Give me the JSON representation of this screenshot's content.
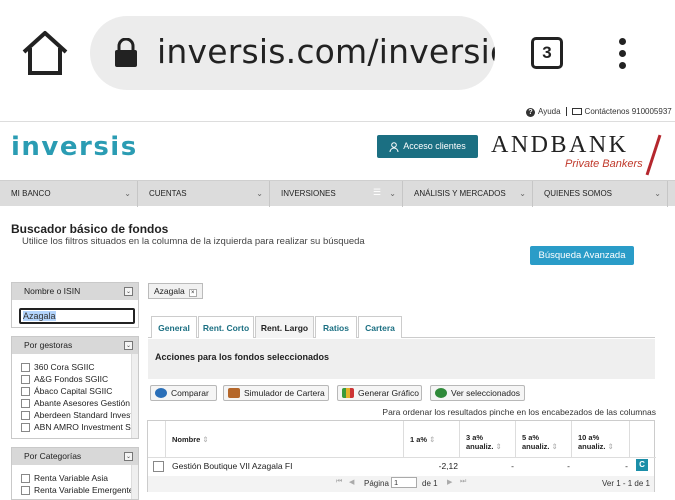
{
  "browser": {
    "url": "inversis.com/inversiones",
    "tab_count": "3"
  },
  "topbar": {
    "help_label": "Ayuda",
    "contact_label": "Contáctenos 910005937"
  },
  "header": {
    "logo_text": "inversis",
    "login_button": "Acceso clientes",
    "partner_logo": "ANDBANK",
    "partner_tagline": "Private Bankers"
  },
  "nav": [
    {
      "label": "MI BANCO"
    },
    {
      "label": "CUENTAS"
    },
    {
      "label": "INVERSIONES"
    },
    {
      "label": "ANÁLISIS Y MERCADOS"
    },
    {
      "label": "QUIENES SOMOS"
    }
  ],
  "page": {
    "title": "Buscador básico de fondos",
    "subtitle": "Utilice los filtros situados en la columna de la izquierda para realizar su búsqueda",
    "advanced_search_button": "Búsqueda Avanzada"
  },
  "filters": {
    "isin": {
      "title": "Nombre o ISIN",
      "value": "Azagala"
    },
    "managers": {
      "title": "Por gestoras",
      "items": [
        "360 Cora SGIIC",
        "A&G Fondos SGIIC",
        "Ábaco Capital SGIIC",
        "Abante Asesores Gestión SGIIC",
        "Aberdeen Standard Investments",
        "ABN AMRO Investment Solutions"
      ]
    },
    "categories": {
      "title": "Por Categorías",
      "items": [
        "Renta Variable Asia",
        "Renta Variable Emergente"
      ]
    }
  },
  "selected_chip": "Azagala",
  "tabs": [
    {
      "label": "General"
    },
    {
      "label": "Rent. Corto"
    },
    {
      "label": "Rent. Largo",
      "active": true
    },
    {
      "label": "Ratios"
    },
    {
      "label": "Cartera"
    }
  ],
  "actions": {
    "title": "Acciones para los fondos seleccionados",
    "buttons": [
      "Comparar",
      "Simulador de Cartera",
      "Generar Gráfico",
      "Ver seleccionados"
    ],
    "order_note": "Para ordenar los resultados pinche en los encabezados de las columnas"
  },
  "table": {
    "headers": [
      "Nombre",
      "1 a%",
      "3 a% anualiz.",
      "5 a% anualiz.",
      "10 a% anualiz."
    ],
    "rows": [
      {
        "name": "Gestión Boutique VII Azagala FI",
        "y1": "-2,12",
        "y3": "-",
        "y5": "-",
        "y10": "-",
        "action": "C"
      }
    ],
    "pager": {
      "page_label": "Página",
      "page_value": "1",
      "of_label": "de 1",
      "range_label": "Ver 1 - 1 de 1"
    }
  }
}
